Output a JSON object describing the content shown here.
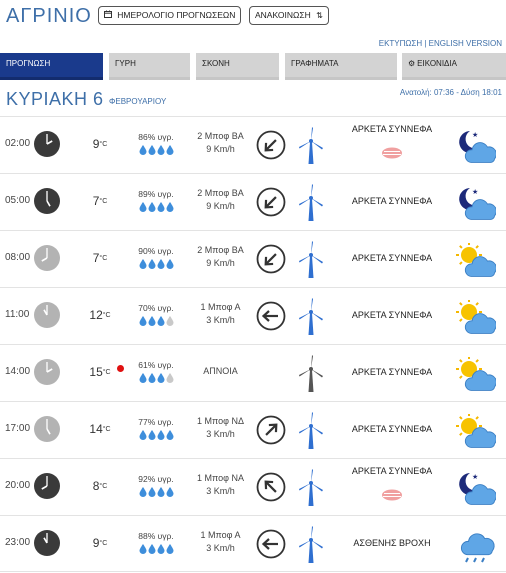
{
  "header": {
    "city": "ΑΓΡΙΝΙΟ",
    "calendar_button": "ΗΜΕΡΟΛΟΓΙΟ ΠΡΟΓΝΩΣΕΩΝ",
    "announcement_button": "ΑΝΑΚΟΙΝΩΣΗ",
    "toplinks": "ΕΚΤΥΠΩΣΗ | ENGLISH VERSION"
  },
  "tabs": [
    {
      "label": "ΠΡΟΓΝΩΣΗ",
      "active": true
    },
    {
      "label": "ΓΥΡΗ",
      "active": false
    },
    {
      "label": "ΣΚΟΝΗ",
      "active": false
    },
    {
      "label": "ΓΡΑΦΗΜΑΤΑ",
      "active": false
    },
    {
      "label": "ΕΙΚΟΝΙΔΙΑ",
      "active": false
    }
  ],
  "date": {
    "day": "ΚΥΡΙΑΚΗ 6",
    "month": "ΦΕΒΡΟΥΑΡΙΟΥ",
    "sun": "Ανατολή: 07:36 - Δύση 18:01"
  },
  "colors": {
    "brand": "#3e6fa8",
    "active_tab": "#1a3a8c",
    "drop_full": "#3e8edb",
    "drop_empty": "#c9c9c9",
    "turbine": "#2f6fd0",
    "turbine_calm": "#555555",
    "clock_night": "#3a3a3a",
    "clock_day": "#b3b3b3",
    "high_dot": "#e01010"
  },
  "rows": [
    {
      "time": "02:00",
      "night": true,
      "temp": "9",
      "unit": "°C",
      "humidity": "86% υγρ.",
      "drops": 4,
      "wind_speed": "2 Μποφ ΒΑ",
      "wind_kmh": "9 Km/h",
      "wind_dir_deg": 45,
      "condition": "ΑΡΚΕΤΑ ΣΥΝΝΕΦΑ",
      "fog": true,
      "icon": "night-partly-cloudy-icon",
      "high": false
    },
    {
      "time": "05:00",
      "night": true,
      "temp": "7",
      "unit": "°C",
      "humidity": "89% υγρ.",
      "drops": 4,
      "wind_speed": "2 Μποφ ΒΑ",
      "wind_kmh": "9 Km/h",
      "wind_dir_deg": 45,
      "condition": "ΑΡΚΕΤΑ ΣΥΝΝΕΦΑ",
      "fog": false,
      "icon": "night-partly-cloudy-icon",
      "high": false
    },
    {
      "time": "08:00",
      "night": false,
      "temp": "7",
      "unit": "°C",
      "humidity": "90% υγρ.",
      "drops": 4,
      "wind_speed": "2 Μποφ ΒΑ",
      "wind_kmh": "9 Km/h",
      "wind_dir_deg": 45,
      "condition": "ΑΡΚΕΤΑ ΣΥΝΝΕΦΑ",
      "fog": false,
      "icon": "day-partly-cloudy-icon",
      "high": false
    },
    {
      "time": "11:00",
      "night": false,
      "temp": "12",
      "unit": "°C",
      "humidity": "70% υγρ.",
      "drops": 3,
      "wind_speed": "1 Μποφ Α",
      "wind_kmh": "3 Km/h",
      "wind_dir_deg": 90,
      "condition": "ΑΡΚΕΤΑ ΣΥΝΝΕΦΑ",
      "fog": false,
      "icon": "day-partly-cloudy-icon",
      "high": false
    },
    {
      "time": "14:00",
      "night": false,
      "temp": "15",
      "unit": "°C",
      "humidity": "61% υγρ.",
      "drops": 3,
      "wind_speed": "ΑΠΝΟΙΑ",
      "wind_kmh": "",
      "wind_dir_deg": null,
      "condition": "ΑΡΚΕΤΑ ΣΥΝΝΕΦΑ",
      "fog": false,
      "icon": "day-partly-cloudy-icon",
      "high": true
    },
    {
      "time": "17:00",
      "night": false,
      "temp": "14",
      "unit": "°C",
      "humidity": "77% υγρ.",
      "drops": 4,
      "wind_speed": "1 Μποφ ΝΔ",
      "wind_kmh": "3 Km/h",
      "wind_dir_deg": 225,
      "condition": "ΑΡΚΕΤΑ ΣΥΝΝΕΦΑ",
      "fog": false,
      "icon": "day-partly-cloudy-icon",
      "high": false
    },
    {
      "time": "20:00",
      "night": true,
      "temp": "8",
      "unit": "°C",
      "humidity": "92% υγρ.",
      "drops": 4,
      "wind_speed": "1 Μποφ ΝΑ",
      "wind_kmh": "3 Km/h",
      "wind_dir_deg": 135,
      "condition": "ΑΡΚΕΤΑ ΣΥΝΝΕΦΑ",
      "fog": true,
      "icon": "night-partly-cloudy-icon",
      "high": false
    },
    {
      "time": "23:00",
      "night": true,
      "temp": "9",
      "unit": "°C",
      "humidity": "88% υγρ.",
      "drops": 4,
      "wind_speed": "1 Μποφ Α",
      "wind_kmh": "3 Km/h",
      "wind_dir_deg": 90,
      "condition": "ΑΣΘΕΝΗΣ ΒΡΟΧΗ",
      "fog": false,
      "icon": "light-rain-icon",
      "high": false
    }
  ]
}
